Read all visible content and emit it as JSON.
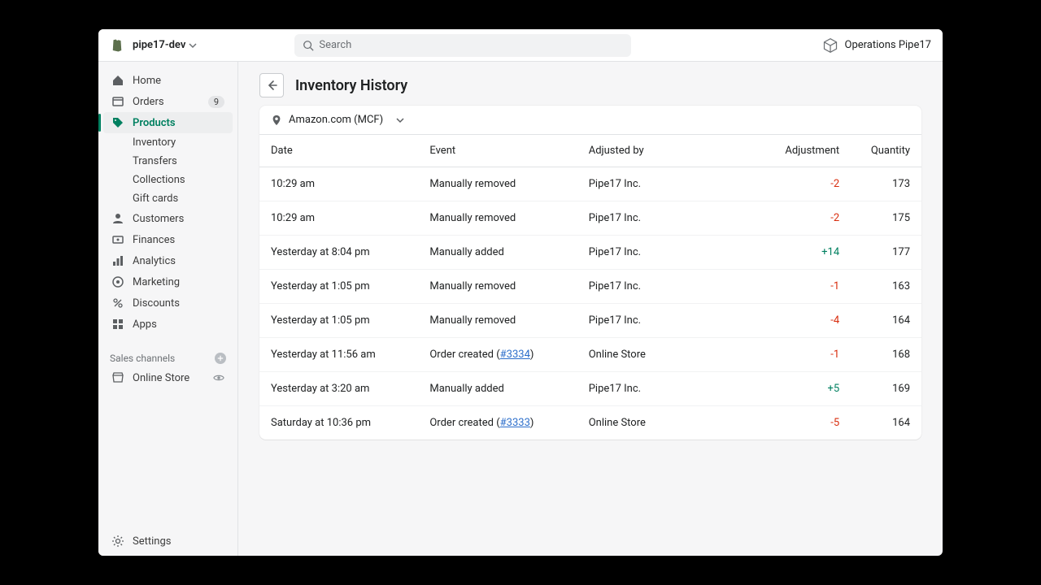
{
  "topbar": {
    "store_name": "pipe17-dev",
    "search_placeholder": "Search",
    "provider_label": "Operations Pipe17"
  },
  "sidebar": {
    "items": [
      {
        "label": "Home"
      },
      {
        "label": "Orders",
        "badge": "9"
      },
      {
        "label": "Products"
      },
      {
        "label": "Customers"
      },
      {
        "label": "Finances"
      },
      {
        "label": "Analytics"
      },
      {
        "label": "Marketing"
      },
      {
        "label": "Discounts"
      },
      {
        "label": "Apps"
      }
    ],
    "product_subitems": [
      {
        "label": "Inventory"
      },
      {
        "label": "Transfers"
      },
      {
        "label": "Collections"
      },
      {
        "label": "Gift cards"
      }
    ],
    "channels_header": "Sales channels",
    "channels": [
      {
        "label": "Online Store"
      }
    ],
    "settings_label": "Settings"
  },
  "page": {
    "title": "Inventory History",
    "location": "Amazon.com (MCF)"
  },
  "table": {
    "columns": {
      "date": "Date",
      "event": "Event",
      "adjusted_by": "Adjusted by",
      "adjustment": "Adjustment",
      "quantity": "Quantity"
    },
    "rows": [
      {
        "date": "10:29 am",
        "event_text": "Manually removed",
        "order_link": null,
        "adjusted_by": "Pipe17 Inc.",
        "adjustment": "-2",
        "adj_sign": "neg",
        "quantity": "173"
      },
      {
        "date": "10:29 am",
        "event_text": "Manually removed",
        "order_link": null,
        "adjusted_by": "Pipe17 Inc.",
        "adjustment": "-2",
        "adj_sign": "neg",
        "quantity": "175"
      },
      {
        "date": "Yesterday at 8:04 pm",
        "event_text": "Manually added",
        "order_link": null,
        "adjusted_by": "Pipe17 Inc.",
        "adjustment": "+14",
        "adj_sign": "pos",
        "quantity": "177"
      },
      {
        "date": "Yesterday at 1:05 pm",
        "event_text": "Manually removed",
        "order_link": null,
        "adjusted_by": "Pipe17 Inc.",
        "adjustment": "-1",
        "adj_sign": "neg",
        "quantity": "163"
      },
      {
        "date": "Yesterday at 1:05 pm",
        "event_text": "Manually removed",
        "order_link": null,
        "adjusted_by": "Pipe17 Inc.",
        "adjustment": "-4",
        "adj_sign": "neg",
        "quantity": "164"
      },
      {
        "date": "Yesterday at 11:56 am",
        "event_text": "Order created",
        "order_link": "#3334",
        "adjusted_by": "Online Store",
        "adjustment": "-1",
        "adj_sign": "neg",
        "quantity": "168"
      },
      {
        "date": "Yesterday at 3:20 am",
        "event_text": "Manually added",
        "order_link": null,
        "adjusted_by": "Pipe17 Inc.",
        "adjustment": "+5",
        "adj_sign": "pos",
        "quantity": "169"
      },
      {
        "date": "Saturday at 10:36 pm",
        "event_text": "Order created",
        "order_link": "#3333",
        "adjusted_by": "Online Store",
        "adjustment": "-5",
        "adj_sign": "neg",
        "quantity": "164"
      }
    ]
  }
}
